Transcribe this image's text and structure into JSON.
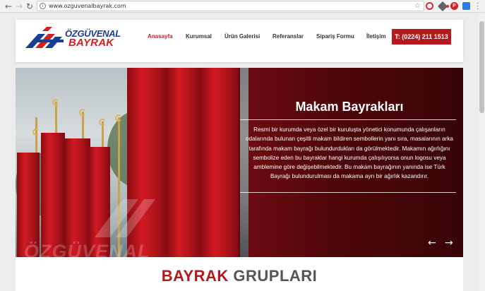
{
  "browser": {
    "url": "www.ozguvenalbayrak.com"
  },
  "site": {
    "logo_line1": "ÖZGÜVENAL",
    "logo_line2": "BAYRAK",
    "nav": [
      "Anasayfa",
      "Kurumsal",
      "Ürün Galerisi",
      "Referanslar",
      "Sipariş Formu",
      "İletişim"
    ],
    "active_nav": "Anasayfa",
    "phone": "T: (0224) 211 1513",
    "accent_color": "#b5191e",
    "brand_blue": "#1b3f8f"
  },
  "hero": {
    "title": "Makam Bayrakları",
    "text": "Resmi bir kurumda veya özel bir kuruluşta yönetici konumunda çalışanların odalarında bulunan çeşitli makam bildiren sembollerin yanı sıra, masalarının arka tarafında makam bayrağı bulundurdukları da görülmektedir. Makamın ağırlığını sembolize eden bu bayraklar hangi kurumda çalışılıyorsa onun logosu veya amblemine göre değişebilmektedir. Bu makam bayrağının yanında ise Türk Bayrağı bulundurulması da makama ayrı bir ağırlık kazandırır.",
    "watermark": "ÖZGÜVENAL",
    "prev_icon": "arrow-left-icon",
    "next_icon": "arrow-right-icon"
  },
  "section": {
    "title_part1": "BAYRAK",
    "title_part2": "GRUPLARI"
  }
}
